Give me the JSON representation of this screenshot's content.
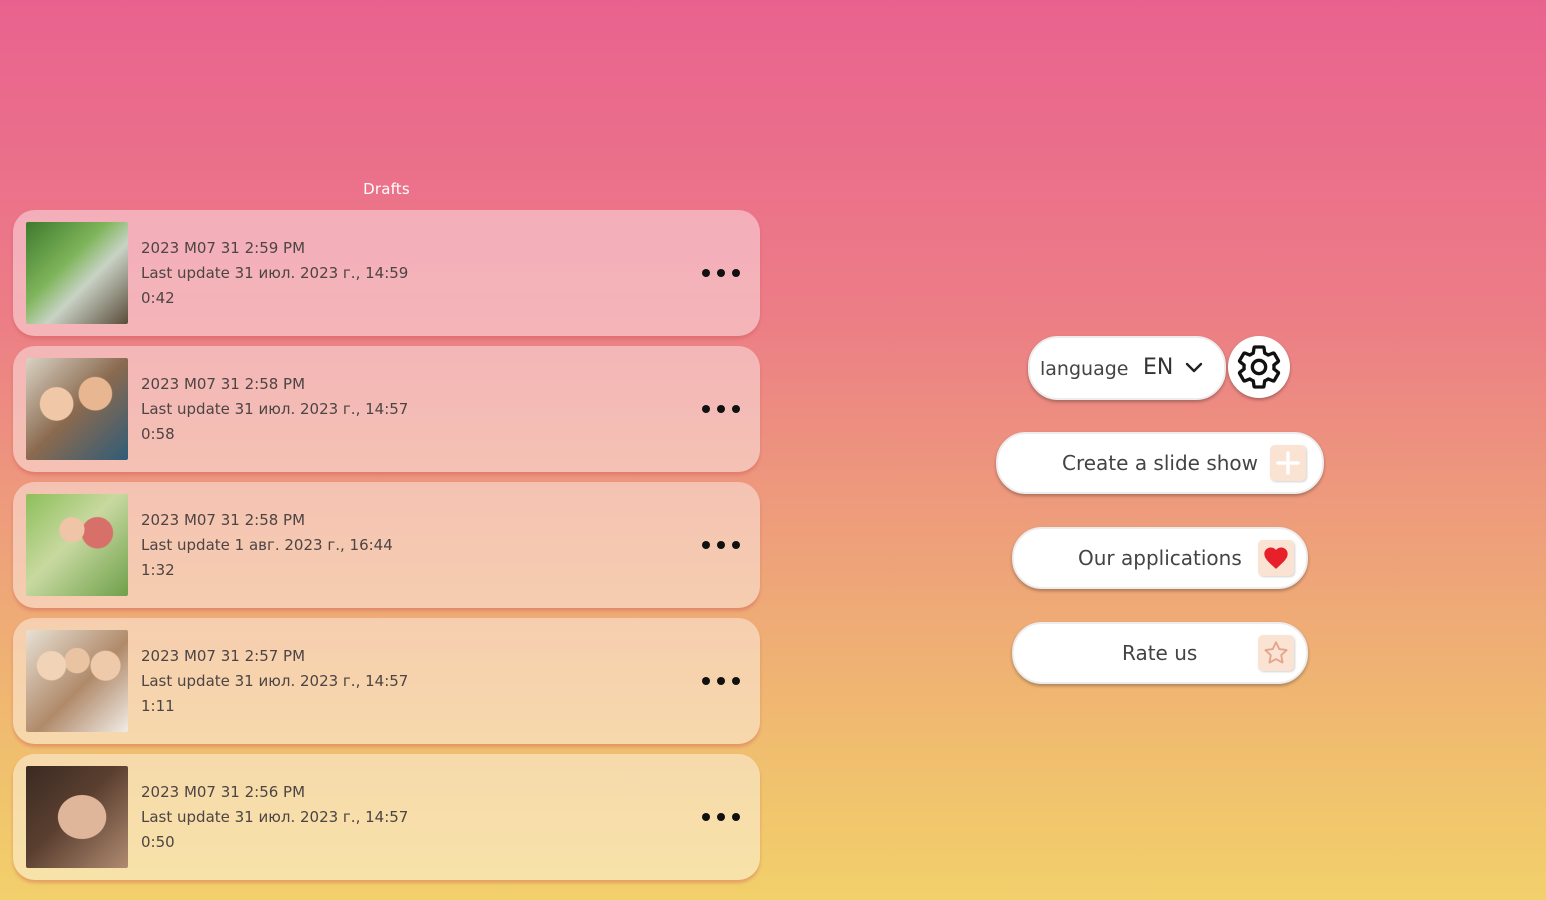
{
  "drafts": {
    "title": "Drafts",
    "items": [
      {
        "title": "2023 M07 31 2:59 PM",
        "updated": "Last update 31 июл. 2023 г., 14:59",
        "duration": "0:42"
      },
      {
        "title": "2023 M07 31 2:58 PM",
        "updated": "Last update 31 июл. 2023 г., 14:57",
        "duration": "0:58"
      },
      {
        "title": "2023 M07 31 2:58 PM",
        "updated": "Last update 1 авг. 2023 г., 16:44",
        "duration": "1:32"
      },
      {
        "title": "2023 M07 31 2:57 PM",
        "updated": "Last update 31 июл. 2023 г., 14:57",
        "duration": "1:11"
      },
      {
        "title": "2023 M07 31 2:56 PM",
        "updated": "Last update 31 июл. 2023 г., 14:57",
        "duration": "0:50"
      }
    ]
  },
  "language": {
    "label": "language",
    "value": "EN"
  },
  "actions": {
    "create": "Create a slide show",
    "apps": "Our applications",
    "rate": "Rate us"
  },
  "icons": {
    "more": "more-dots-icon",
    "settings": "gear-icon",
    "chevron": "chevron-down-icon",
    "create": "plus-icon",
    "apps": "heart-icon",
    "rate": "star-icon"
  },
  "colors": {
    "gradient_top": "#e9628f",
    "gradient_bottom": "#f2d06b",
    "heart": "#e8202a"
  }
}
